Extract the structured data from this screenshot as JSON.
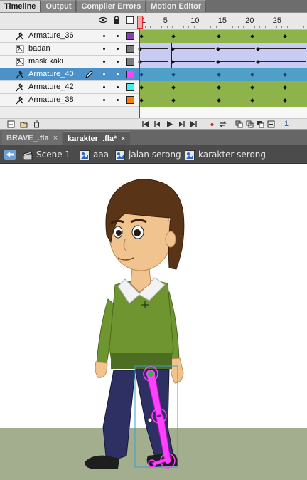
{
  "panel_tabs": [
    {
      "label": "Timeline",
      "active": true
    },
    {
      "label": "Output",
      "active": false
    },
    {
      "label": "Compiler Errors",
      "active": false
    },
    {
      "label": "Motion Editor",
      "active": false
    }
  ],
  "header_icons": [
    "eye-icon",
    "lock-icon",
    "outline-icon"
  ],
  "ruler_numbers": [
    "1",
    "5",
    "10",
    "15",
    "20",
    "25"
  ],
  "layers": [
    {
      "name": "Armature_36",
      "icon": "armature-icon",
      "color": "#8a3cc2",
      "frames": "green",
      "selected": false
    },
    {
      "name": "badan",
      "icon": "mask-icon",
      "color": "#7a7a7a",
      "frames": "blue",
      "selected": false
    },
    {
      "name": "mask kaki",
      "icon": "mask-icon",
      "color": "#7a7a7a",
      "frames": "blue",
      "selected": false
    },
    {
      "name": "Armature_40",
      "icon": "armature-icon",
      "color": "#ff40ff",
      "frames": "teal",
      "selected": true
    },
    {
      "name": "Armature_42",
      "icon": "armature-icon",
      "color": "#40f0f0",
      "frames": "green",
      "selected": false
    },
    {
      "name": "Armature_38",
      "icon": "armature-icon",
      "color": "#ff7a00",
      "frames": "green",
      "selected": false
    }
  ],
  "current_frame": "1",
  "doc_tabs": [
    {
      "label": "BRAVE_.fla",
      "close": "×",
      "active": false
    },
    {
      "label": "karakter_.fla*",
      "close": "×",
      "active": true
    }
  ],
  "breadcrumb": [
    {
      "label": "Scene 1",
      "icon": "scene-clapper-icon"
    },
    {
      "label": "aaa",
      "icon": "symbol-icon"
    },
    {
      "label": "jalan serong",
      "icon": "symbol-icon"
    },
    {
      "label": "karakter serong",
      "icon": "symbol-icon"
    }
  ],
  "colors": {
    "ground": "#a3ae8e",
    "sweater": "#6f9530",
    "pants": "#2e2f63",
    "hair": "#5a3417",
    "skin": "#f1c48f",
    "bone": "#ff40ff"
  }
}
